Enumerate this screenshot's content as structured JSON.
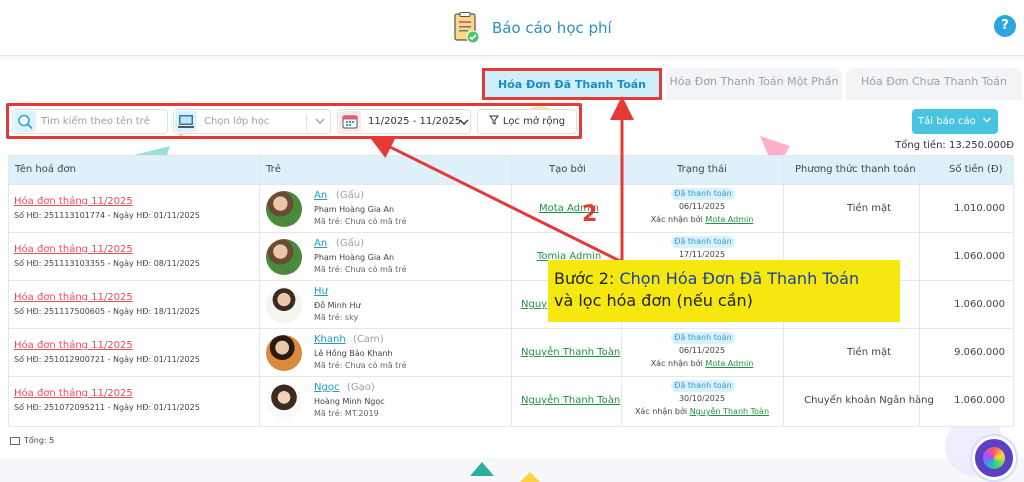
{
  "header": {
    "title": "Báo cáo học phí",
    "help_label": "?"
  },
  "tabs": [
    {
      "label": "Hóa Đơn Đã Thanh Toán",
      "active": true
    },
    {
      "label": "Hóa Đơn Thanh Toán Một Phần",
      "active": false
    },
    {
      "label": "Hóa Đơn Chưa Thanh Toán",
      "active": false
    }
  ],
  "filters": {
    "search_placeholder": "Tìm kiếm theo tên trẻ",
    "class_placeholder": "Chọn lớp học",
    "date_range": "11/2025 - 11/2025",
    "advanced_filter_label": "Lọc mở rộng"
  },
  "toolbar": {
    "report_button_label": "Tải báo cáo",
    "total_label": "Tổng tiền:",
    "total_value": "13.250.000Đ"
  },
  "table": {
    "columns": [
      "Tên hoá đơn",
      "Trẻ",
      "Tạo bởi",
      "Trạng thái",
      "Phương thức thanh toán",
      "Số tiền (Đ)"
    ],
    "rows": [
      {
        "invoice_title": "Hóa đơn tháng 11/2025",
        "invoice_meta": "Số HĐ: 251113101774 - Ngày HĐ: 01/11/2025",
        "child_name": "An",
        "child_nick": "(Gấu)",
        "child_full": "Phạm Hoàng Gia An",
        "child_code": "Mã trẻ: Chưa có mã trẻ",
        "creator": "Mota Admin",
        "status": "Đã thanh toán",
        "status_date": "06/11/2025",
        "confirm_prefix": "Xác nhận bởi",
        "confirm_by": "Mota Admin",
        "payment_method": "Tiền mặt",
        "amount": "1.010.000"
      },
      {
        "invoice_title": "Hóa đơn tháng 11/2025",
        "invoice_meta": "Số HĐ: 251113103355 - Ngày HĐ: 08/11/2025",
        "child_name": "An",
        "child_nick": "(Gấu)",
        "child_full": "Phạm Hoàng Gia An",
        "child_code": "Mã trẻ: Chưa có mã trẻ",
        "creator": "Tomia Admin",
        "status": "Đã thanh toán",
        "status_date": "17/11/2025",
        "confirm_prefix": "",
        "confirm_by": "",
        "payment_method": "",
        "amount": "1.060.000"
      },
      {
        "invoice_title": "Hóa đơn tháng 11/2025",
        "invoice_meta": "Số HĐ: 251117500605 - Ngày HĐ: 18/11/2025",
        "child_name": "Hư",
        "child_nick": "",
        "child_full": "Đỗ Minh Hư",
        "child_code": "Mã trẻ: sky",
        "creator": "Nguy",
        "status": "",
        "status_date": "",
        "confirm_prefix": "",
        "confirm_by": "",
        "payment_method": "",
        "amount": "1.060.000"
      },
      {
        "invoice_title": "Hóa đơn tháng 11/2025",
        "invoice_meta": "Số HĐ: 251012900721 - Ngày HĐ: 01/11/2025",
        "child_name": "Khanh",
        "child_nick": "(Cam)",
        "child_full": "Lê Hồng Bảo Khanh",
        "child_code": "Mã trẻ: Chưa có mã trẻ",
        "creator": "Nguyễn Thanh Toàn",
        "status": "Đã thanh toán",
        "status_date": "06/11/2025",
        "confirm_prefix": "Xác nhận bởi",
        "confirm_by": "Mota Admin",
        "payment_method": "Tiền mặt",
        "amount": "9.060.000"
      },
      {
        "invoice_title": "Hóa đơn tháng 11/2025",
        "invoice_meta": "Số HĐ: 251072095211 - Ngày HĐ: 01/11/2025",
        "child_name": "Ngọc",
        "child_nick": "(Gạo)",
        "child_full": "Hoàng Minh Ngọc",
        "child_code": "Mã trẻ: MT.2019",
        "creator": "Nguyễn Thanh Toàn",
        "status": "Đã thanh toán",
        "status_date": "30/10/2025",
        "confirm_prefix": "Xác nhận bởi",
        "confirm_by": "Nguyễn Thanh Toàn",
        "payment_method": "Chuyển khoản Ngân hàng",
        "amount": "1.060.000"
      }
    ],
    "footer": "Tổng: 5"
  },
  "annotation": {
    "step_number": "2",
    "callout_prefix": "Bước 2:",
    "callout_part1": "Chọn",
    "callout_highlight": "Hóa Đơn Đã Thanh Toán",
    "callout_line2": "và lọc hóa đơn (nếu cần)"
  },
  "colors": {
    "accent": "#2aa7df",
    "invoice_link": "#e54e5f",
    "creator_link": "#21923f",
    "annotation_red": "#e53935",
    "callout_bg": "#f6e70f"
  }
}
